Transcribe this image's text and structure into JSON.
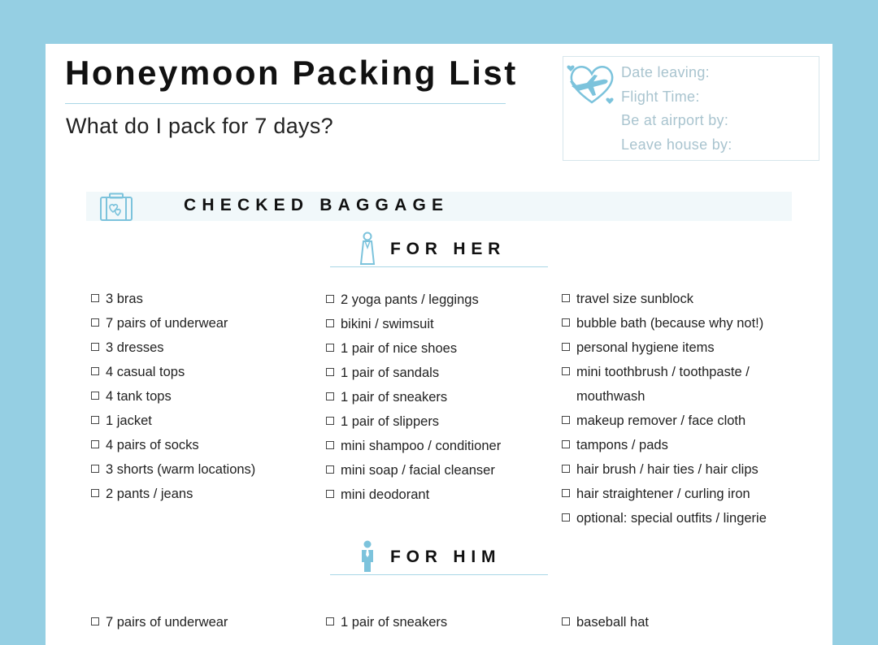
{
  "title": "Honeymoon Packing List",
  "subtitle": "What do I pack for 7 days?",
  "info_box": {
    "icon": "airplane-heart-icon",
    "lines": [
      "Date leaving:",
      "Flight Time:",
      "Be at airport by:",
      "Leave house by:"
    ]
  },
  "banner": {
    "icon": "suitcase-icon",
    "label": "CHECKED BAGGAGE"
  },
  "sections": {
    "her": {
      "icon": "woman-icon",
      "label": "FOR HER",
      "col1": [
        "3 bras",
        "7 pairs of underwear",
        "3 dresses",
        "4 casual tops",
        "4 tank tops",
        "1 jacket",
        "4 pairs of socks",
        "3 shorts (warm locations)",
        "2 pants / jeans"
      ],
      "col2": [
        "2 yoga pants / leggings",
        "bikini / swimsuit",
        "1 pair of nice shoes",
        "1 pair of sandals",
        "1 pair of sneakers",
        "1 pair of slippers",
        "mini shampoo / conditioner",
        "mini soap / facial cleanser",
        "mini deodorant"
      ],
      "col3": [
        "travel size sunblock",
        "bubble bath (because why not!)",
        "personal hygiene items",
        "mini toothbrush / toothpaste /",
        "mouthwash",
        "makeup remover / face cloth",
        "tampons / pads",
        "hair brush / hair ties / hair clips",
        "hair straightener / curling iron",
        "optional: special outfits / lingerie"
      ]
    },
    "him": {
      "icon": "man-icon",
      "label": "FOR HIM",
      "col1": [
        "7 pairs of underwear"
      ],
      "col2": [
        "1 pair of sneakers"
      ],
      "col3": [
        "baseball hat"
      ]
    }
  },
  "colors": {
    "background": "#95cfe3",
    "accent": "#7cc3dc",
    "rule": "#a9d6e6"
  }
}
